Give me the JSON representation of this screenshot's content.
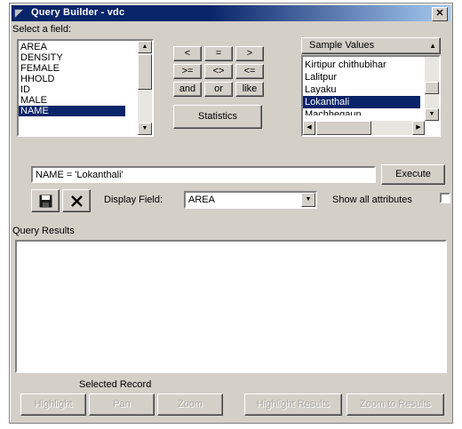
{
  "window": {
    "title": "Query Builder - vdc",
    "close_glyph": "✕"
  },
  "fields": {
    "label": "Select a field:",
    "items": [
      "AREA",
      "DENSITY",
      "FEMALE",
      "HHOLD",
      "ID",
      "MALE",
      "NAME"
    ],
    "selected": "NAME"
  },
  "operators": [
    [
      "<",
      "=",
      ">"
    ],
    [
      ">=",
      "<>",
      "<="
    ],
    [
      "and",
      "or",
      "like"
    ]
  ],
  "statistics_label": "Statistics",
  "sample": {
    "header": "Sample Values",
    "items": [
      "Kirtipur chithubihar",
      "Lalitpur",
      "Layaku",
      "Lokanthali",
      "Machhegaun"
    ],
    "selected": "Lokanthali"
  },
  "query": {
    "value": "NAME = 'Lokanthali'",
    "execute_label": "Execute"
  },
  "display_field": {
    "label": "Display Field:",
    "value": "AREA"
  },
  "show_all": {
    "label": "Show all attributes",
    "checked": false
  },
  "results": {
    "label": "Query Results"
  },
  "selected_record": {
    "label": "Selected Record",
    "buttons": [
      "Highlight",
      "Pan",
      "Zoom",
      "Highlight Results",
      "Zoom to Results"
    ]
  },
  "icons": {
    "save": "floppy-disk-icon",
    "clear": "x-icon",
    "window": "app-icon"
  }
}
